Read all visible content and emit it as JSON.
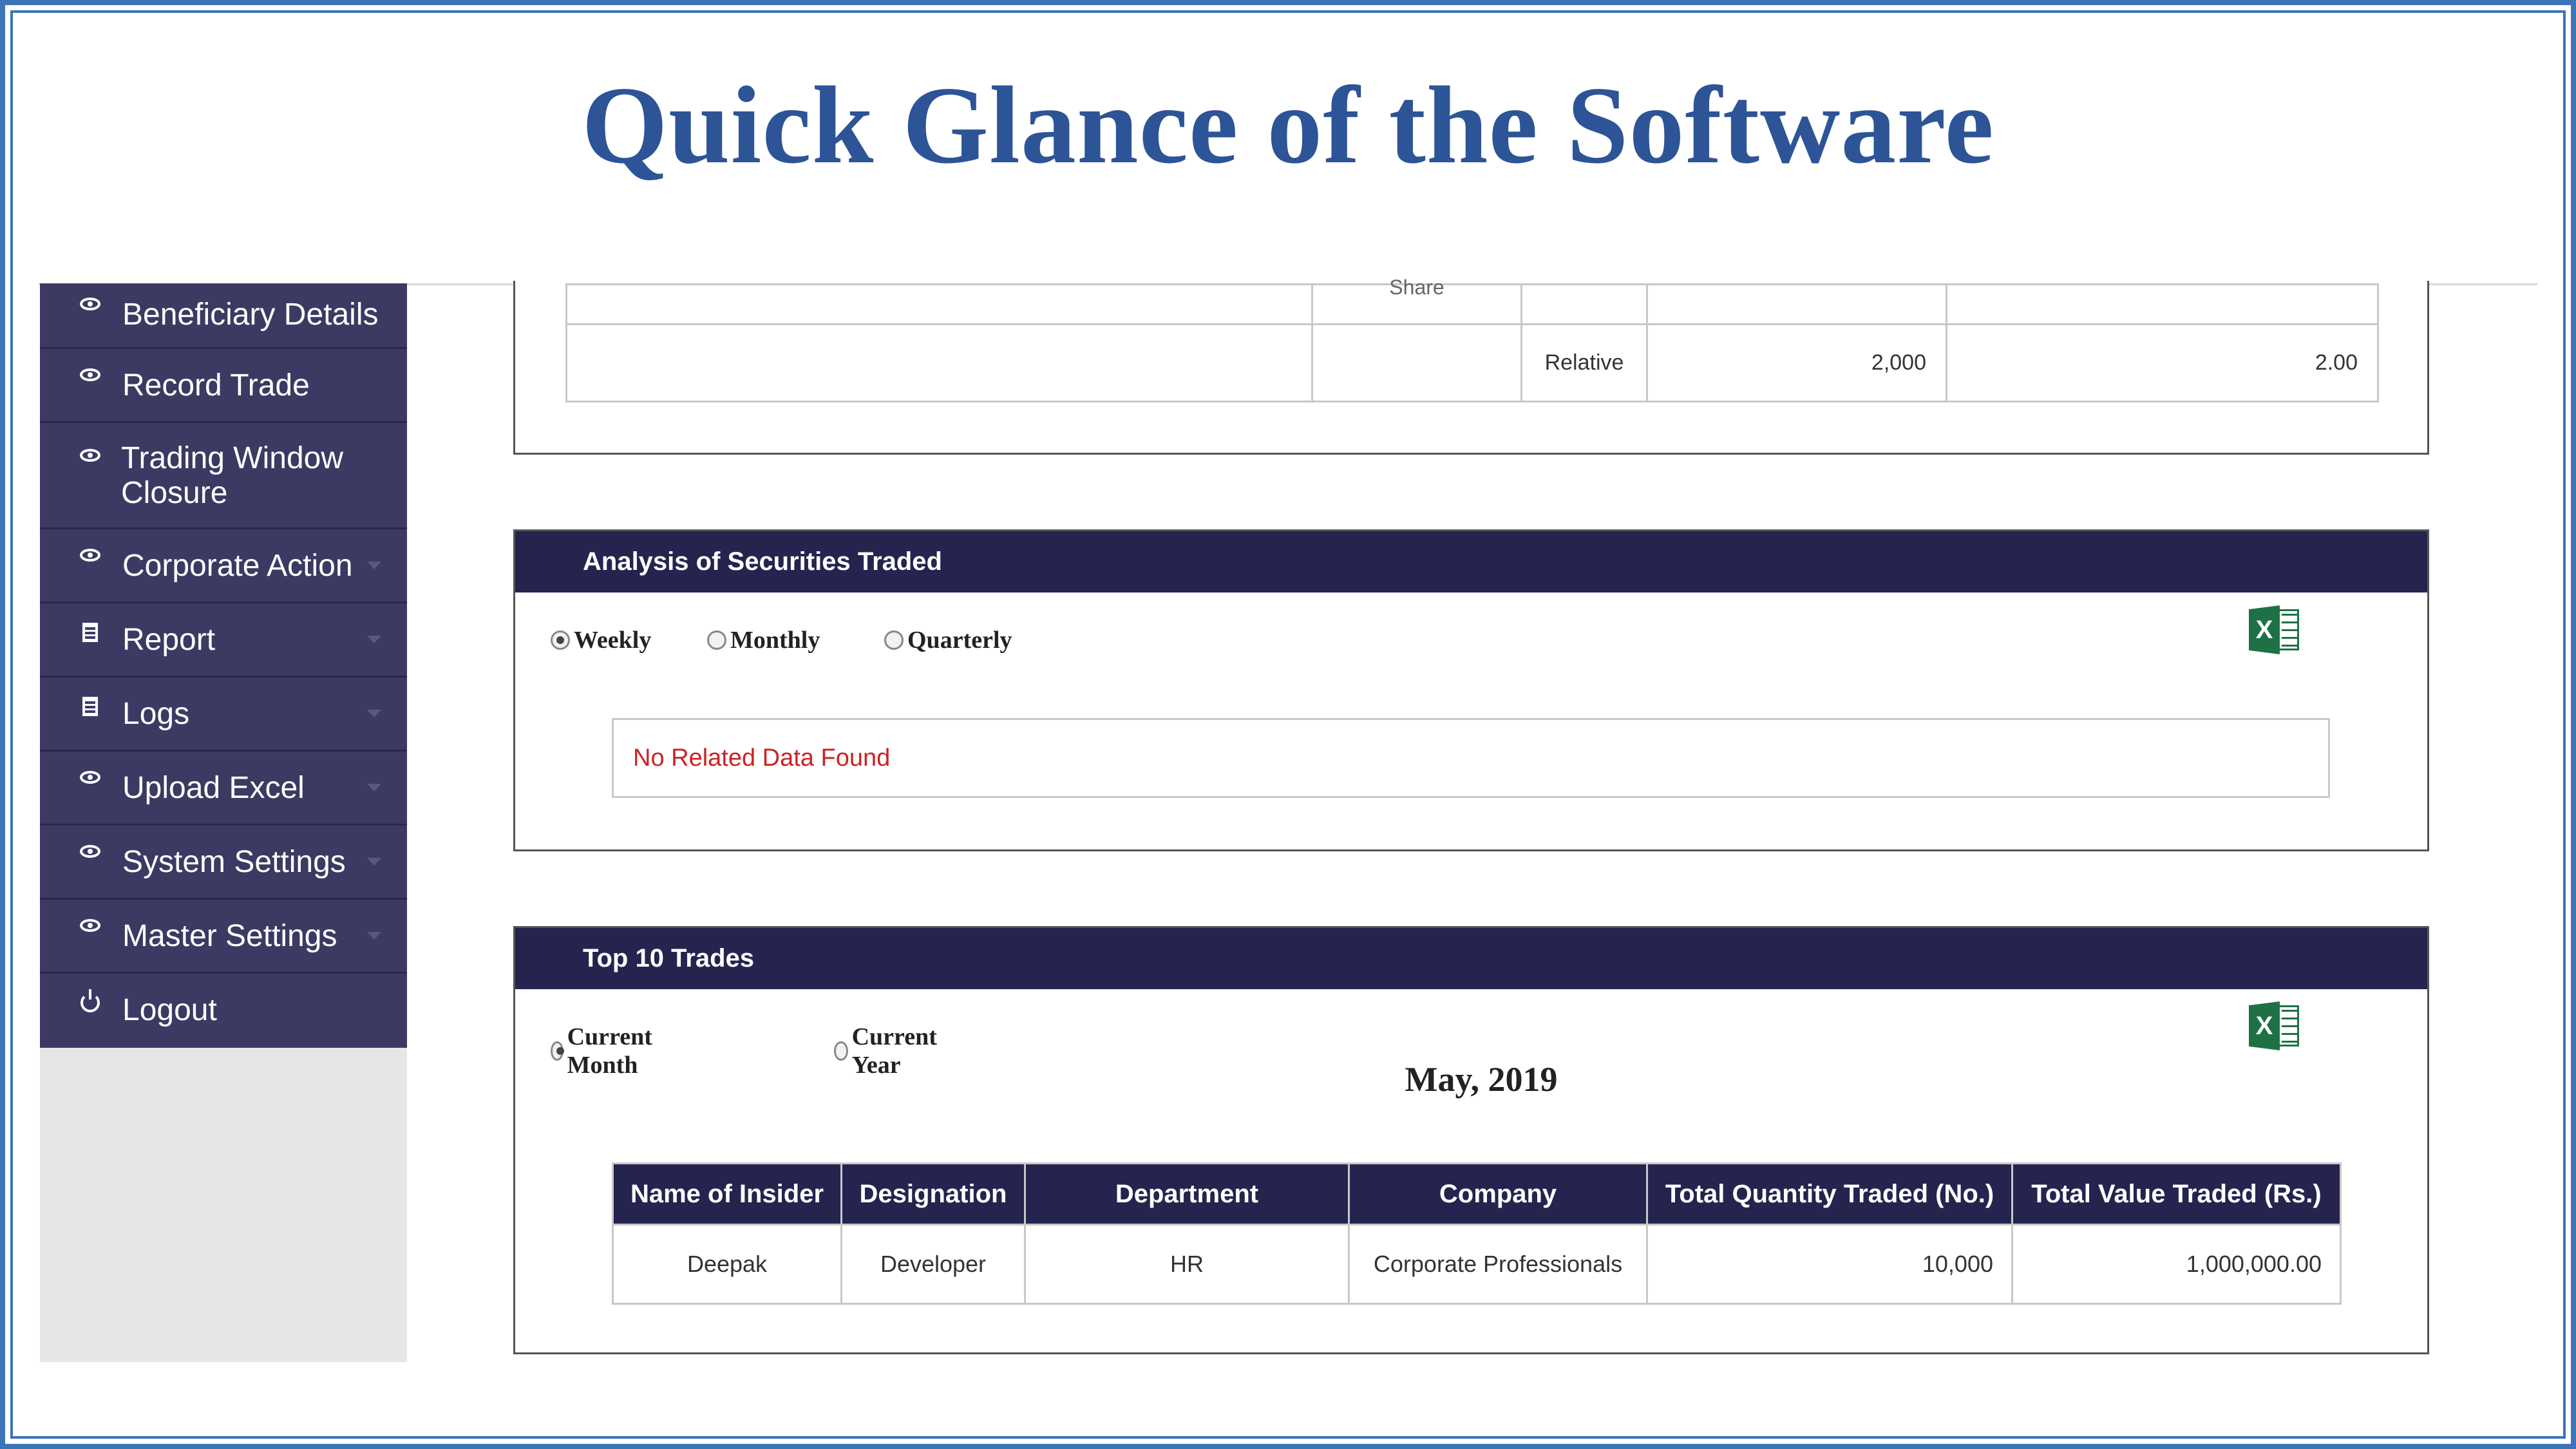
{
  "slide": {
    "title": "Quick Glance of the Software"
  },
  "sidebar": {
    "items": [
      {
        "label": "Beneficiary Details",
        "icon": "eye-icon",
        "has_caret": false
      },
      {
        "label": "Record Trade",
        "icon": "eye-icon",
        "has_caret": false
      },
      {
        "label": "Trading Window Closure",
        "icon": "eye-icon",
        "has_caret": false
      },
      {
        "label": "Corporate Action",
        "icon": "eye-icon",
        "has_caret": true
      },
      {
        "label": "Report",
        "icon": "document-icon",
        "has_caret": true
      },
      {
        "label": "Logs",
        "icon": "document-icon",
        "has_caret": true
      },
      {
        "label": "Upload Excel",
        "icon": "eye-icon",
        "has_caret": true
      },
      {
        "label": "System Settings",
        "icon": "eye-icon",
        "has_caret": true
      },
      {
        "label": "Master Settings",
        "icon": "eye-icon",
        "has_caret": true
      },
      {
        "label": "Logout",
        "icon": "power-icon",
        "has_caret": false
      }
    ]
  },
  "top_table_fragment": {
    "partial_text": "Share",
    "row": {
      "type": "Relative",
      "quantity": "2,000",
      "value": "2.00"
    }
  },
  "analysis_panel": {
    "title": "Analysis of Securities Traded",
    "options": [
      {
        "label": "Weekly",
        "selected": true
      },
      {
        "label": "Monthly",
        "selected": false
      },
      {
        "label": "Quarterly",
        "selected": false
      }
    ],
    "empty_message": "No Related Data Found",
    "export_icon": "excel-icon"
  },
  "top_trades_panel": {
    "title": "Top 10 Trades",
    "options": [
      {
        "label": "Current Month",
        "selected": true
      },
      {
        "label": "Current Year",
        "selected": false
      }
    ],
    "period_label": "May, 2019",
    "export_icon": "excel-icon",
    "table": {
      "headers": [
        "Name of Insider",
        "Designation",
        "Department",
        "Company",
        "Total Quantity Traded (No.)",
        "Total Value Traded (Rs.)"
      ],
      "rows": [
        [
          "Deepak",
          "Developer",
          "HR",
          "Corporate Professionals",
          "10,000",
          "1,000,000.00"
        ]
      ]
    }
  },
  "colors": {
    "title": "#2d5496",
    "frame": "#3c74b8",
    "sidebar_bg": "#3c3a62",
    "panel_header_bg": "#25244f",
    "empty_message": "#cc2222",
    "excel_green": "#1e7145"
  }
}
